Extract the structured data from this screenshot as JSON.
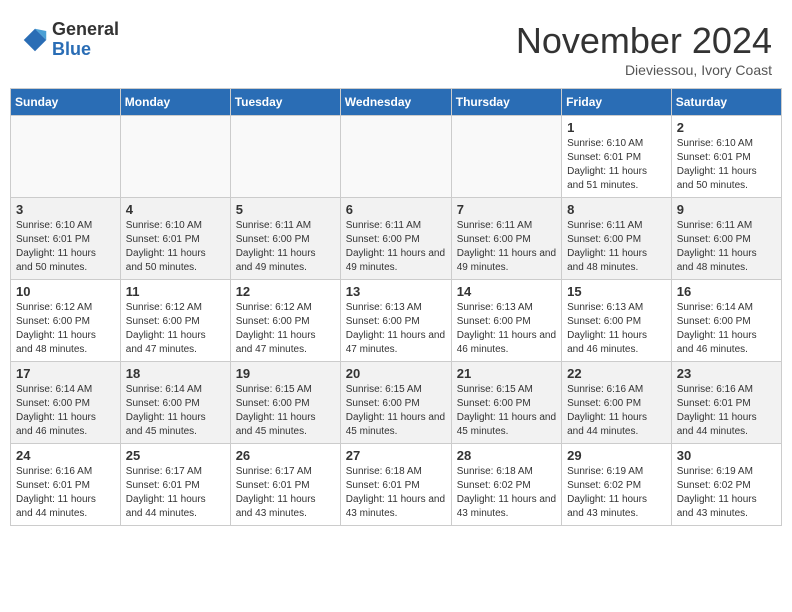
{
  "header": {
    "logo_general": "General",
    "logo_blue": "Blue",
    "month_title": "November 2024",
    "subtitle": "Dieviessou, Ivory Coast"
  },
  "days_of_week": [
    "Sunday",
    "Monday",
    "Tuesday",
    "Wednesday",
    "Thursday",
    "Friday",
    "Saturday"
  ],
  "weeks": [
    [
      {
        "day": "",
        "info": ""
      },
      {
        "day": "",
        "info": ""
      },
      {
        "day": "",
        "info": ""
      },
      {
        "day": "",
        "info": ""
      },
      {
        "day": "",
        "info": ""
      },
      {
        "day": "1",
        "info": "Sunrise: 6:10 AM\nSunset: 6:01 PM\nDaylight: 11 hours and 51 minutes."
      },
      {
        "day": "2",
        "info": "Sunrise: 6:10 AM\nSunset: 6:01 PM\nDaylight: 11 hours and 50 minutes."
      }
    ],
    [
      {
        "day": "3",
        "info": "Sunrise: 6:10 AM\nSunset: 6:01 PM\nDaylight: 11 hours and 50 minutes."
      },
      {
        "day": "4",
        "info": "Sunrise: 6:10 AM\nSunset: 6:01 PM\nDaylight: 11 hours and 50 minutes."
      },
      {
        "day": "5",
        "info": "Sunrise: 6:11 AM\nSunset: 6:00 PM\nDaylight: 11 hours and 49 minutes."
      },
      {
        "day": "6",
        "info": "Sunrise: 6:11 AM\nSunset: 6:00 PM\nDaylight: 11 hours and 49 minutes."
      },
      {
        "day": "7",
        "info": "Sunrise: 6:11 AM\nSunset: 6:00 PM\nDaylight: 11 hours and 49 minutes."
      },
      {
        "day": "8",
        "info": "Sunrise: 6:11 AM\nSunset: 6:00 PM\nDaylight: 11 hours and 48 minutes."
      },
      {
        "day": "9",
        "info": "Sunrise: 6:11 AM\nSunset: 6:00 PM\nDaylight: 11 hours and 48 minutes."
      }
    ],
    [
      {
        "day": "10",
        "info": "Sunrise: 6:12 AM\nSunset: 6:00 PM\nDaylight: 11 hours and 48 minutes."
      },
      {
        "day": "11",
        "info": "Sunrise: 6:12 AM\nSunset: 6:00 PM\nDaylight: 11 hours and 47 minutes."
      },
      {
        "day": "12",
        "info": "Sunrise: 6:12 AM\nSunset: 6:00 PM\nDaylight: 11 hours and 47 minutes."
      },
      {
        "day": "13",
        "info": "Sunrise: 6:13 AM\nSunset: 6:00 PM\nDaylight: 11 hours and 47 minutes."
      },
      {
        "day": "14",
        "info": "Sunrise: 6:13 AM\nSunset: 6:00 PM\nDaylight: 11 hours and 46 minutes."
      },
      {
        "day": "15",
        "info": "Sunrise: 6:13 AM\nSunset: 6:00 PM\nDaylight: 11 hours and 46 minutes."
      },
      {
        "day": "16",
        "info": "Sunrise: 6:14 AM\nSunset: 6:00 PM\nDaylight: 11 hours and 46 minutes."
      }
    ],
    [
      {
        "day": "17",
        "info": "Sunrise: 6:14 AM\nSunset: 6:00 PM\nDaylight: 11 hours and 46 minutes."
      },
      {
        "day": "18",
        "info": "Sunrise: 6:14 AM\nSunset: 6:00 PM\nDaylight: 11 hours and 45 minutes."
      },
      {
        "day": "19",
        "info": "Sunrise: 6:15 AM\nSunset: 6:00 PM\nDaylight: 11 hours and 45 minutes."
      },
      {
        "day": "20",
        "info": "Sunrise: 6:15 AM\nSunset: 6:00 PM\nDaylight: 11 hours and 45 minutes."
      },
      {
        "day": "21",
        "info": "Sunrise: 6:15 AM\nSunset: 6:00 PM\nDaylight: 11 hours and 45 minutes."
      },
      {
        "day": "22",
        "info": "Sunrise: 6:16 AM\nSunset: 6:00 PM\nDaylight: 11 hours and 44 minutes."
      },
      {
        "day": "23",
        "info": "Sunrise: 6:16 AM\nSunset: 6:01 PM\nDaylight: 11 hours and 44 minutes."
      }
    ],
    [
      {
        "day": "24",
        "info": "Sunrise: 6:16 AM\nSunset: 6:01 PM\nDaylight: 11 hours and 44 minutes."
      },
      {
        "day": "25",
        "info": "Sunrise: 6:17 AM\nSunset: 6:01 PM\nDaylight: 11 hours and 44 minutes."
      },
      {
        "day": "26",
        "info": "Sunrise: 6:17 AM\nSunset: 6:01 PM\nDaylight: 11 hours and 43 minutes."
      },
      {
        "day": "27",
        "info": "Sunrise: 6:18 AM\nSunset: 6:01 PM\nDaylight: 11 hours and 43 minutes."
      },
      {
        "day": "28",
        "info": "Sunrise: 6:18 AM\nSunset: 6:02 PM\nDaylight: 11 hours and 43 minutes."
      },
      {
        "day": "29",
        "info": "Sunrise: 6:19 AM\nSunset: 6:02 PM\nDaylight: 11 hours and 43 minutes."
      },
      {
        "day": "30",
        "info": "Sunrise: 6:19 AM\nSunset: 6:02 PM\nDaylight: 11 hours and 43 minutes."
      }
    ]
  ]
}
